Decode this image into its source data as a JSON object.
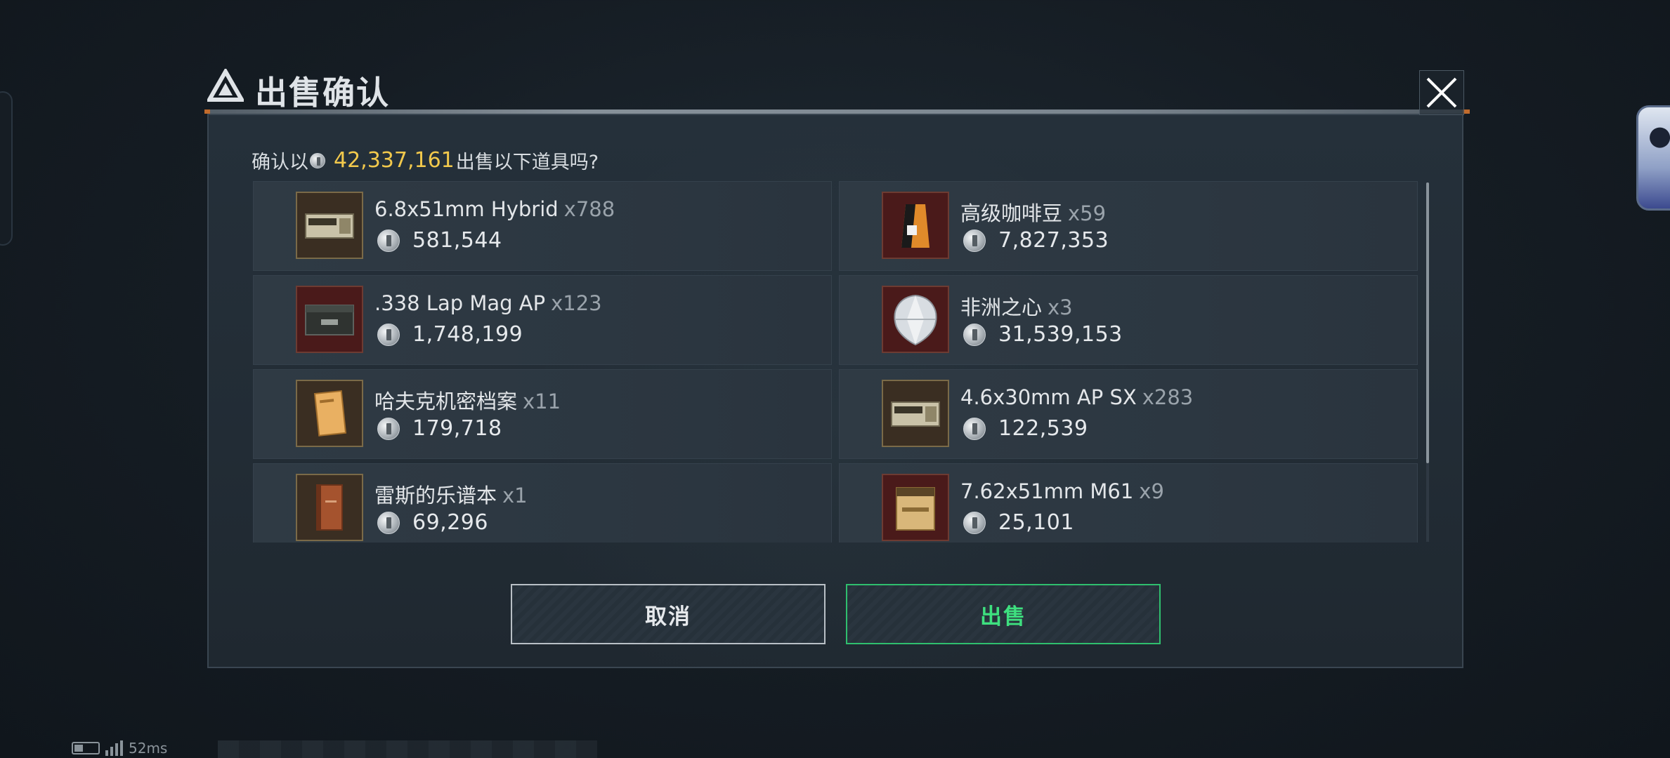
{
  "dialog": {
    "title": "出售确认",
    "close_label": "✕"
  },
  "prompt": {
    "prefix": "确认以",
    "amount": "42,337,161",
    "suffix": "出售以下道具吗?"
  },
  "items": [
    {
      "name": "6.8x51mm Hybrid",
      "qty": "x788",
      "price": "581,544",
      "icon": "ammo-box-icon"
    },
    {
      "name": "高级咖啡豆",
      "qty": "x59",
      "price": "7,827,353",
      "icon": "coffee-bag-icon"
    },
    {
      "name": ".338 Lap Mag AP",
      "qty": "x123",
      "price": "1,748,199",
      "icon": "ammo-crate-icon"
    },
    {
      "name": "非洲之心",
      "qty": "x3",
      "price": "31,539,153",
      "icon": "diamond-icon"
    },
    {
      "name": "哈夫克机密档案",
      "qty": "x11",
      "price": "179,718",
      "icon": "document-folder-icon"
    },
    {
      "name": "4.6x30mm AP SX",
      "qty": "x283",
      "price": "122,539",
      "icon": "ammo-box-icon"
    },
    {
      "name": "雷斯的乐谱本",
      "qty": "x1",
      "price": "69,296",
      "icon": "music-book-icon"
    },
    {
      "name": "7.62x51mm M61",
      "qty": "x9",
      "price": "25,101",
      "icon": "ammo-carton-icon"
    }
  ],
  "buttons": {
    "cancel": "取消",
    "sell": "出售"
  },
  "status": {
    "latency": "52ms"
  },
  "colors": {
    "amount": "#f2c94c",
    "sell_accent": "#2fbf6e",
    "header_accent": "#e07a2e"
  }
}
